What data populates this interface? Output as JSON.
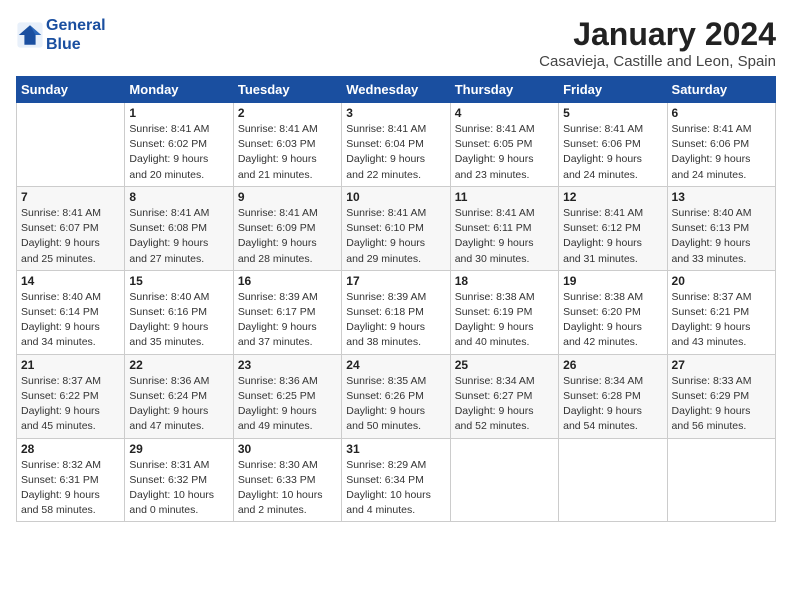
{
  "logo": {
    "line1": "General",
    "line2": "Blue"
  },
  "title": "January 2024",
  "subtitle": "Casavieja, Castille and Leon, Spain",
  "days_of_week": [
    "Sunday",
    "Monday",
    "Tuesday",
    "Wednesday",
    "Thursday",
    "Friday",
    "Saturday"
  ],
  "weeks": [
    [
      {
        "num": "",
        "info": ""
      },
      {
        "num": "1",
        "info": "Sunrise: 8:41 AM\nSunset: 6:02 PM\nDaylight: 9 hours\nand 20 minutes."
      },
      {
        "num": "2",
        "info": "Sunrise: 8:41 AM\nSunset: 6:03 PM\nDaylight: 9 hours\nand 21 minutes."
      },
      {
        "num": "3",
        "info": "Sunrise: 8:41 AM\nSunset: 6:04 PM\nDaylight: 9 hours\nand 22 minutes."
      },
      {
        "num": "4",
        "info": "Sunrise: 8:41 AM\nSunset: 6:05 PM\nDaylight: 9 hours\nand 23 minutes."
      },
      {
        "num": "5",
        "info": "Sunrise: 8:41 AM\nSunset: 6:06 PM\nDaylight: 9 hours\nand 24 minutes."
      },
      {
        "num": "6",
        "info": "Sunrise: 8:41 AM\nSunset: 6:06 PM\nDaylight: 9 hours\nand 24 minutes."
      }
    ],
    [
      {
        "num": "7",
        "info": "Sunrise: 8:41 AM\nSunset: 6:07 PM\nDaylight: 9 hours\nand 25 minutes."
      },
      {
        "num": "8",
        "info": "Sunrise: 8:41 AM\nSunset: 6:08 PM\nDaylight: 9 hours\nand 27 minutes."
      },
      {
        "num": "9",
        "info": "Sunrise: 8:41 AM\nSunset: 6:09 PM\nDaylight: 9 hours\nand 28 minutes."
      },
      {
        "num": "10",
        "info": "Sunrise: 8:41 AM\nSunset: 6:10 PM\nDaylight: 9 hours\nand 29 minutes."
      },
      {
        "num": "11",
        "info": "Sunrise: 8:41 AM\nSunset: 6:11 PM\nDaylight: 9 hours\nand 30 minutes."
      },
      {
        "num": "12",
        "info": "Sunrise: 8:41 AM\nSunset: 6:12 PM\nDaylight: 9 hours\nand 31 minutes."
      },
      {
        "num": "13",
        "info": "Sunrise: 8:40 AM\nSunset: 6:13 PM\nDaylight: 9 hours\nand 33 minutes."
      }
    ],
    [
      {
        "num": "14",
        "info": "Sunrise: 8:40 AM\nSunset: 6:14 PM\nDaylight: 9 hours\nand 34 minutes."
      },
      {
        "num": "15",
        "info": "Sunrise: 8:40 AM\nSunset: 6:16 PM\nDaylight: 9 hours\nand 35 minutes."
      },
      {
        "num": "16",
        "info": "Sunrise: 8:39 AM\nSunset: 6:17 PM\nDaylight: 9 hours\nand 37 minutes."
      },
      {
        "num": "17",
        "info": "Sunrise: 8:39 AM\nSunset: 6:18 PM\nDaylight: 9 hours\nand 38 minutes."
      },
      {
        "num": "18",
        "info": "Sunrise: 8:38 AM\nSunset: 6:19 PM\nDaylight: 9 hours\nand 40 minutes."
      },
      {
        "num": "19",
        "info": "Sunrise: 8:38 AM\nSunset: 6:20 PM\nDaylight: 9 hours\nand 42 minutes."
      },
      {
        "num": "20",
        "info": "Sunrise: 8:37 AM\nSunset: 6:21 PM\nDaylight: 9 hours\nand 43 minutes."
      }
    ],
    [
      {
        "num": "21",
        "info": "Sunrise: 8:37 AM\nSunset: 6:22 PM\nDaylight: 9 hours\nand 45 minutes."
      },
      {
        "num": "22",
        "info": "Sunrise: 8:36 AM\nSunset: 6:24 PM\nDaylight: 9 hours\nand 47 minutes."
      },
      {
        "num": "23",
        "info": "Sunrise: 8:36 AM\nSunset: 6:25 PM\nDaylight: 9 hours\nand 49 minutes."
      },
      {
        "num": "24",
        "info": "Sunrise: 8:35 AM\nSunset: 6:26 PM\nDaylight: 9 hours\nand 50 minutes."
      },
      {
        "num": "25",
        "info": "Sunrise: 8:34 AM\nSunset: 6:27 PM\nDaylight: 9 hours\nand 52 minutes."
      },
      {
        "num": "26",
        "info": "Sunrise: 8:34 AM\nSunset: 6:28 PM\nDaylight: 9 hours\nand 54 minutes."
      },
      {
        "num": "27",
        "info": "Sunrise: 8:33 AM\nSunset: 6:29 PM\nDaylight: 9 hours\nand 56 minutes."
      }
    ],
    [
      {
        "num": "28",
        "info": "Sunrise: 8:32 AM\nSunset: 6:31 PM\nDaylight: 9 hours\nand 58 minutes."
      },
      {
        "num": "29",
        "info": "Sunrise: 8:31 AM\nSunset: 6:32 PM\nDaylight: 10 hours\nand 0 minutes."
      },
      {
        "num": "30",
        "info": "Sunrise: 8:30 AM\nSunset: 6:33 PM\nDaylight: 10 hours\nand 2 minutes."
      },
      {
        "num": "31",
        "info": "Sunrise: 8:29 AM\nSunset: 6:34 PM\nDaylight: 10 hours\nand 4 minutes."
      },
      {
        "num": "",
        "info": ""
      },
      {
        "num": "",
        "info": ""
      },
      {
        "num": "",
        "info": ""
      }
    ]
  ]
}
